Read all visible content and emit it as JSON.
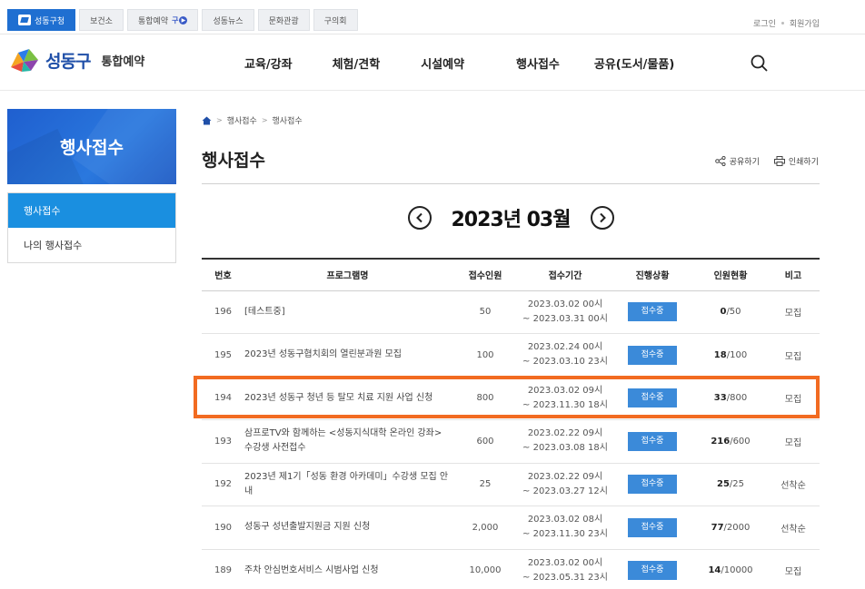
{
  "util": {
    "tabs": [
      {
        "label": "성동구청",
        "active": true
      },
      {
        "label": "보건소",
        "active": false
      },
      {
        "label": "통합예약",
        "active": false
      },
      {
        "label": "성동뉴스",
        "active": false
      },
      {
        "label": "문화관광",
        "active": false
      },
      {
        "label": "구의회",
        "active": false
      }
    ],
    "reserve_mark": "구",
    "login": "로그인",
    "join": "회원가입"
  },
  "header": {
    "logo_text": "성동구",
    "logo_sub": "통합예약",
    "gnb": [
      "교육/강좌",
      "체험/견학",
      "시설예약",
      "행사접수",
      "공유(도서/물품)"
    ]
  },
  "lnb": {
    "title": "행사접수",
    "items": [
      {
        "label": "행사접수",
        "active": true
      },
      {
        "label": "나의 행사접수",
        "active": false
      }
    ]
  },
  "content": {
    "breadcrumb": [
      "행사접수",
      "행사접수"
    ],
    "title": "행사접수",
    "share": "공유하기",
    "print": "인쇄하기",
    "month": "2023년 03월"
  },
  "table": {
    "headers": [
      "번호",
      "프로그램명",
      "접수인원",
      "접수기간",
      "진행상황",
      "인원현황",
      "비고"
    ],
    "rows": [
      {
        "no": "196",
        "name": "[테스트중]",
        "capacity": "50",
        "period_start": "2023.03.02 00시",
        "period_end": "~ 2023.03.31 00시",
        "status": "접수중",
        "applied": "0",
        "total": "/50",
        "note": "모집"
      },
      {
        "no": "195",
        "name": "2023년 성동구협치회의 열린분과원 모집",
        "capacity": "100",
        "period_start": "2023.02.24 00시",
        "period_end": "~ 2023.03.10 23시",
        "status": "접수중",
        "applied": "18",
        "total": "/100",
        "note": "모집"
      },
      {
        "no": "194",
        "name": "2023년 성동구 청년 등 탈모 치료 지원 사업 신청",
        "capacity": "800",
        "period_start": "2023.03.02 09시",
        "period_end": "~ 2023.11.30 18시",
        "status": "접수중",
        "applied": "33",
        "total": "/800",
        "note": "모집"
      },
      {
        "no": "193",
        "name": "삼프로TV와 함께하는 <성동지식대학 온라인 강좌> 수강생 사전접수",
        "capacity": "600",
        "period_start": "2023.02.22 09시",
        "period_end": "~ 2023.03.08 18시",
        "status": "접수중",
        "applied": "216",
        "total": "/600",
        "note": "모집"
      },
      {
        "no": "192",
        "name": "2023년 제1기「성동 환경 아카데미」수강생 모집 안내",
        "capacity": "25",
        "period_start": "2023.02.22 09시",
        "period_end": "~ 2023.03.27 12시",
        "status": "접수중",
        "applied": "25",
        "total": "/25",
        "note": "선착순"
      },
      {
        "no": "190",
        "name": "성동구 성년출발지원금 지원 신청",
        "capacity": "2,000",
        "period_start": "2023.03.02 08시",
        "period_end": "~ 2023.11.30 23시",
        "status": "접수중",
        "applied": "77",
        "total": "/2000",
        "note": "선착순"
      },
      {
        "no": "189",
        "name": "주차 안심번호서비스 시범사업 신청",
        "capacity": "10,000",
        "period_start": "2023.03.02 00시",
        "period_end": "~ 2023.05.31 23시",
        "status": "접수중",
        "applied": "14",
        "total": "/10000",
        "note": "모집"
      }
    ]
  },
  "colors": {
    "brand_blue": "#1f6fd1",
    "lnb_active": "#1a8fe0",
    "status_badge": "#3b8ad9",
    "highlight": "#f26b21"
  }
}
